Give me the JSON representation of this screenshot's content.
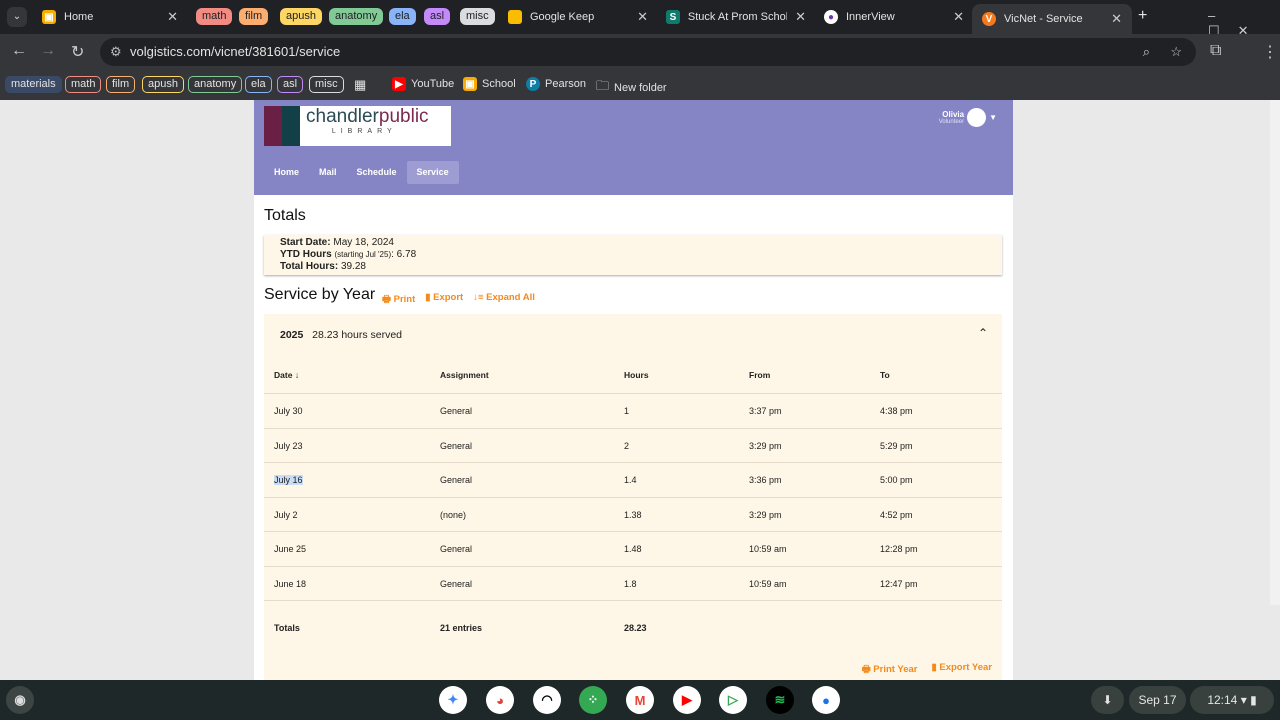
{
  "browser": {
    "tabs": [
      {
        "label": "Home"
      },
      {
        "label": "Google Keep"
      },
      {
        "label": "Stuck At Prom Scholar"
      },
      {
        "label": "InnerView"
      },
      {
        "label": "VicNet - Service"
      }
    ],
    "tab_groups": [
      {
        "label": "math",
        "color": "#f28b82"
      },
      {
        "label": "film",
        "color": "#fcad70"
      },
      {
        "label": "apush",
        "color": "#fdd663"
      },
      {
        "label": "anatomy",
        "color": "#81c995"
      },
      {
        "label": "ela",
        "color": "#8ab4f8"
      },
      {
        "label": "asl",
        "color": "#c58af9"
      },
      {
        "label": "misc",
        "color": "#dadce0"
      }
    ],
    "url": "volgistics.com/vicnet/381601/service",
    "bookmark_groups": [
      {
        "label": "materials",
        "color": "#8ab4f8"
      },
      {
        "label": "math",
        "color": "#f28b82"
      },
      {
        "label": "film",
        "color": "#fcad70"
      },
      {
        "label": "apush",
        "color": "#fdd663"
      },
      {
        "label": "anatomy",
        "color": "#81c995"
      },
      {
        "label": "ela",
        "color": "#8ab4f8"
      },
      {
        "label": "asl",
        "color": "#c58af9"
      },
      {
        "label": "misc",
        "color": "#dadce0"
      }
    ],
    "bookmarks": [
      {
        "label": "YouTube"
      },
      {
        "label": "School"
      },
      {
        "label": "Pearson"
      },
      {
        "label": "New folder"
      }
    ]
  },
  "site": {
    "logo": {
      "word1": "chandler",
      "word2": "public",
      "sub": "LIBRARY"
    },
    "user": {
      "name": "Olivia",
      "role": "Volunteer"
    },
    "nav": [
      "Home",
      "Mail",
      "Schedule",
      "Service"
    ],
    "accent": "#8585c6"
  },
  "totals": {
    "title": "Totals",
    "start_label": "Start Date:",
    "start": "May 18, 2024",
    "ytd_label": "YTD Hours",
    "ytd_note": "(starting Jul '25)",
    "ytd": ": 6.78",
    "total_label": "Total Hours:",
    "total": "39.28"
  },
  "service": {
    "title": "Service by Year",
    "print": "Print",
    "export": "Export",
    "expand": "Expand All",
    "year": "2025",
    "summary": "28.23 hours served",
    "headers": [
      "Date",
      "Assignment",
      "Hours",
      "From",
      "To"
    ],
    "rows": [
      [
        "July 30",
        "General",
        "1",
        "3:37 pm",
        "4:38 pm"
      ],
      [
        "July 23",
        "General",
        "2",
        "3:29 pm",
        "5:29 pm"
      ],
      [
        "July 16",
        "General",
        "1.4",
        "3:36 pm",
        "5:00 pm"
      ],
      [
        "July 2",
        "(none)",
        "1.38",
        "3:29 pm",
        "4:52 pm"
      ],
      [
        "June 25",
        "General",
        "1.48",
        "10:59 am",
        "12:28 pm"
      ],
      [
        "June 18",
        "General",
        "1.8",
        "10:59 am",
        "12:47 pm"
      ]
    ],
    "totals_row": [
      "Totals",
      "21 entries",
      "28.23"
    ],
    "print_year": "Print Year",
    "export_year": "Export Year"
  },
  "system": {
    "date": "Sep 17",
    "time": "12:14"
  }
}
